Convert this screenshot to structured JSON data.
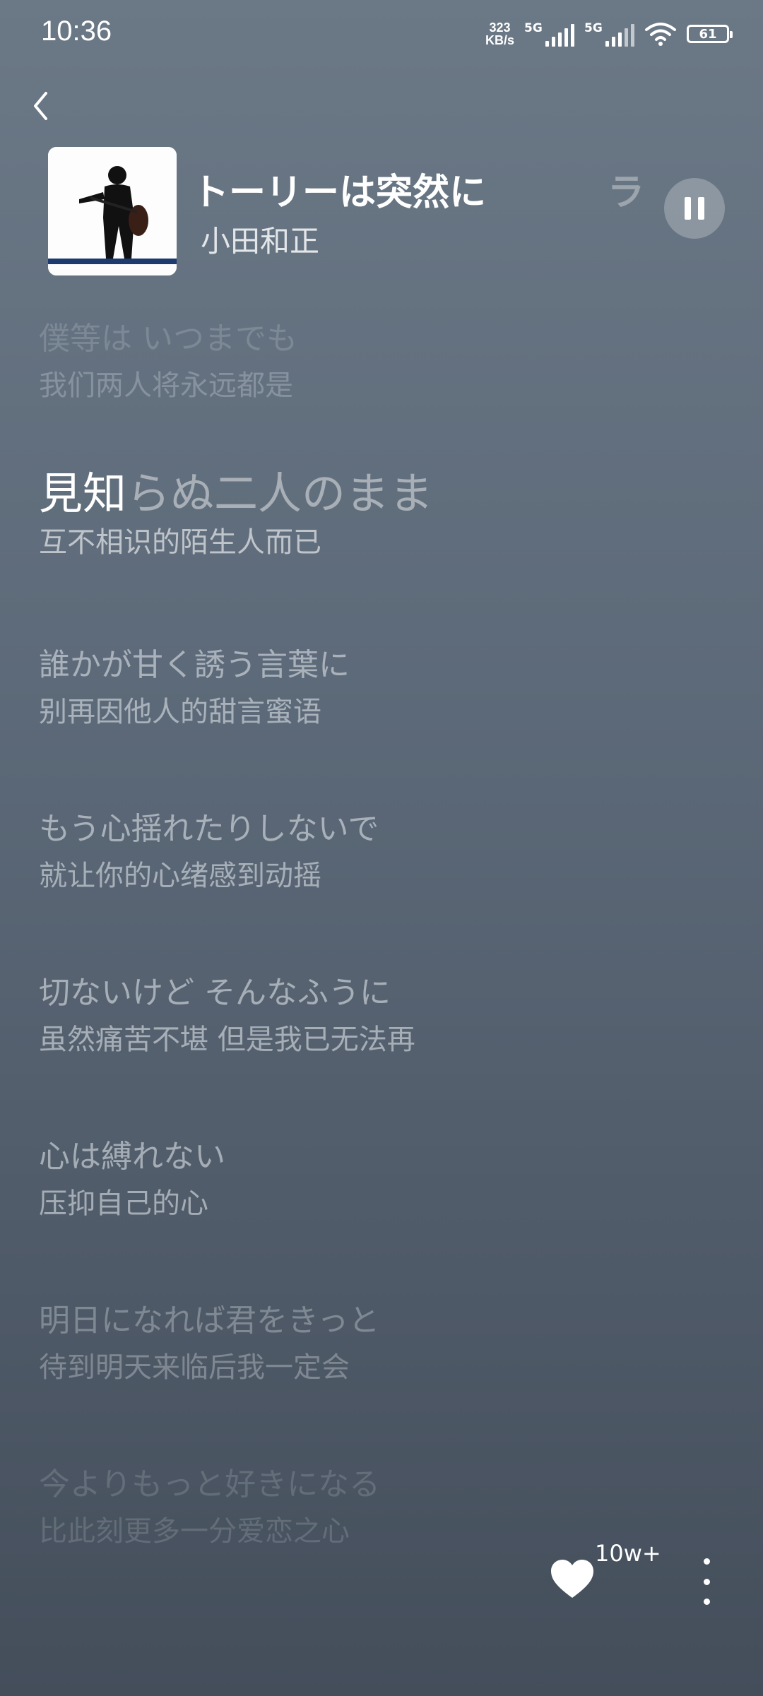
{
  "status_bar": {
    "time": "10:36",
    "net_speed_value": "323",
    "net_speed_unit": "KB/s",
    "sim1_label": "5G",
    "sim2_label": "5G",
    "battery": "61"
  },
  "now_playing": {
    "title": "ストーリーは突然に",
    "title_ghost": "ラ",
    "artist": "小田和正"
  },
  "lyrics": [
    {
      "jp": "僕等は いつまでも",
      "cn": "我们两人将永远都是"
    },
    {
      "jp_highlight": "見知",
      "jp_rest": "らぬ二人のまま",
      "cn": "互不相识的陌生人而已"
    },
    {
      "jp": "誰かが甘く誘う言葉に",
      "cn": "别再因他人的甜言蜜语"
    },
    {
      "jp": "もう心揺れたりしないで",
      "cn": "就让你的心绪感到动摇"
    },
    {
      "jp": "切ないけど そんなふうに",
      "cn": "虽然痛苦不堪 但是我已无法再"
    },
    {
      "jp": "心は縛れない",
      "cn": "压抑自己的心"
    },
    {
      "jp": "明日になれば君をきっと",
      "cn": "待到明天来临后我一定会"
    },
    {
      "jp": "今よりもっと好きになる",
      "cn": "比此刻更多一分爱恋之心"
    }
  ],
  "actions": {
    "like_count": "10w+"
  },
  "colors": {
    "background_top": "#6b7886",
    "background_bottom": "#444e5b",
    "highlight": "#ffffff"
  }
}
